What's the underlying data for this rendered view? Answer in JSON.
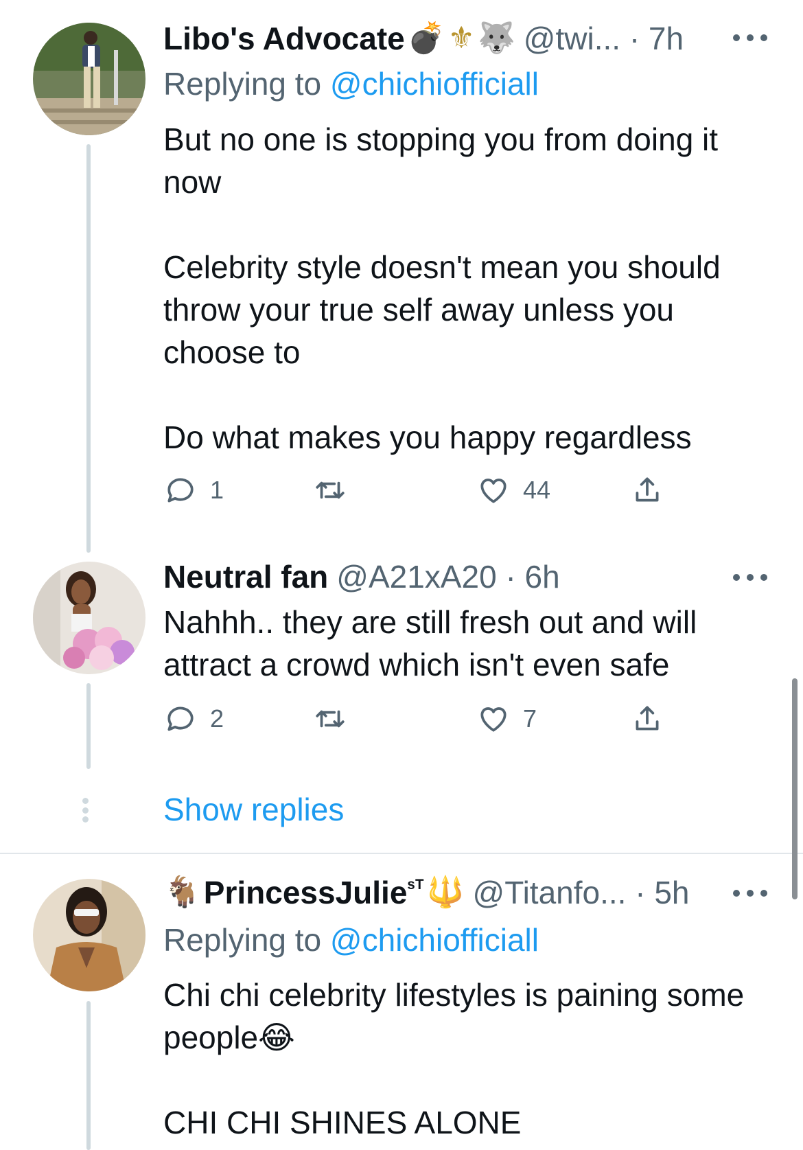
{
  "tweets": [
    {
      "name": "Libo's Advocate",
      "name_emojis": [
        "💣",
        "⚜",
        "🐺"
      ],
      "handle_time": "@twi... · 7h",
      "replying_prefix": "Replying to ",
      "replying_handle": "@chichiofficiall",
      "body": [
        "But no one is stopping you from doing it now",
        "Celebrity style doesn't mean you should throw your true self away unless you choose to",
        "Do what makes you happy regardless"
      ],
      "reply_count": "1",
      "like_count": "44"
    },
    {
      "name": "Neutral fan",
      "handle_time": "@A21xA20 · 6h",
      "body": [
        "Nahhh.. they are still fresh out and will attract a crowd which isn't even safe"
      ],
      "reply_count": "2",
      "like_count": "7"
    },
    {
      "name_prefix_emoji": "🐐",
      "name": "PrincessJulie",
      "name_suffix": "ˢᵀ",
      "name_emojis": [
        "🔱"
      ],
      "handle_time": "@Titanfo... · 5h",
      "replying_prefix": "Replying to ",
      "replying_handle": "@chichiofficiall",
      "body": [
        "Chi chi celebrity lifestyles is paining some people😂",
        "CHI CHI SHINES ALONE"
      ]
    }
  ],
  "show_replies_label": "Show replies",
  "icons": [
    "reply-icon",
    "retweet-icon",
    "like-icon",
    "share-icon",
    "more-icon"
  ],
  "colors": {
    "link": "#1d9bf0",
    "secondary_text": "#536471",
    "thread_line": "#cfd9de"
  }
}
